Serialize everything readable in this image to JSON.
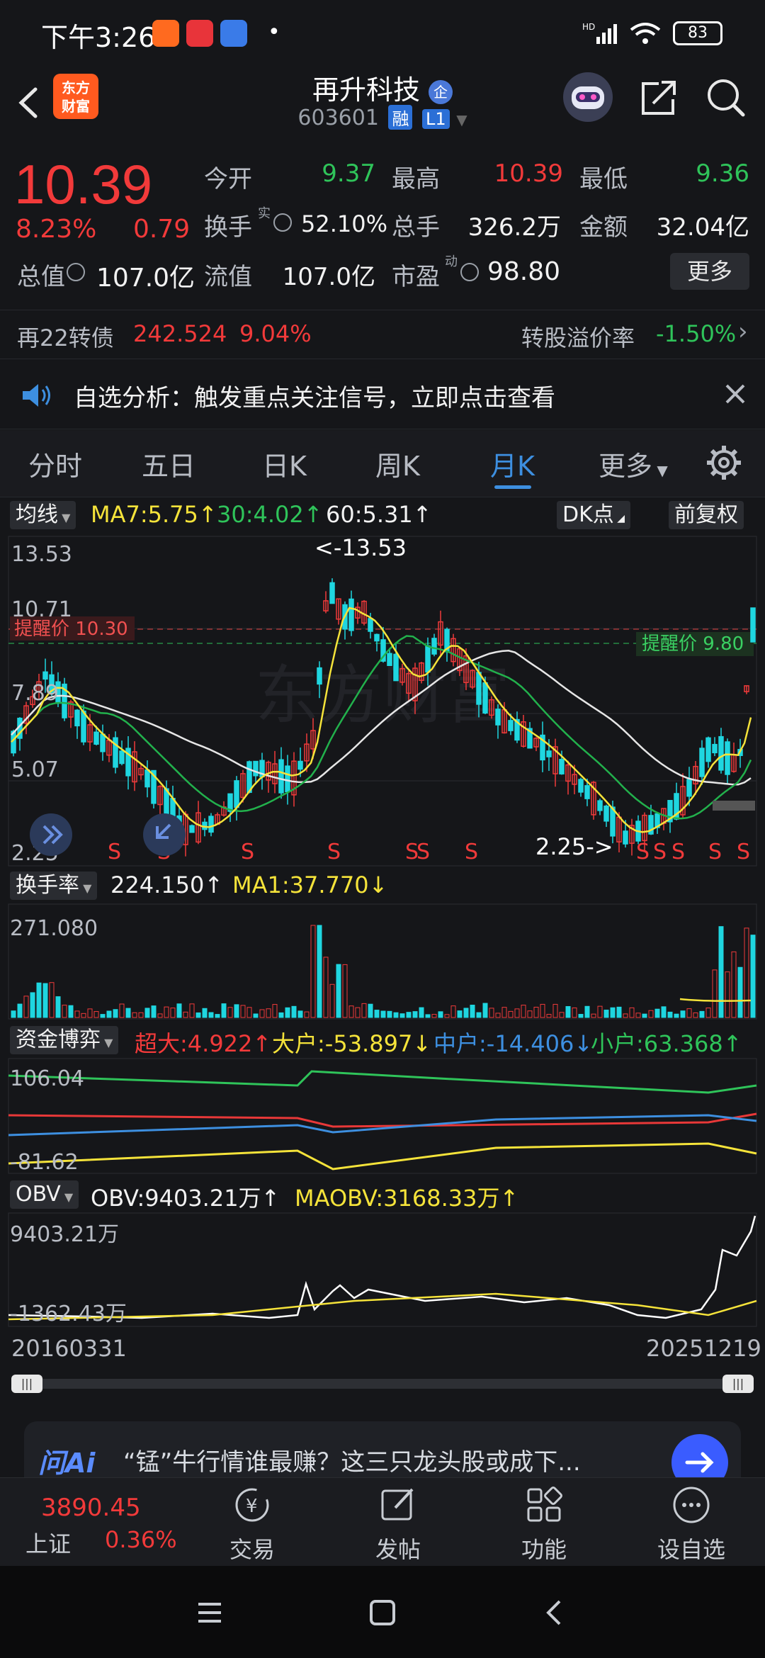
{
  "status": {
    "time": "下午3:26",
    "battery": "83",
    "signal": "HD"
  },
  "header": {
    "logo_top": "东方",
    "logo_bottom": "财富",
    "title": "再升科技",
    "title_badge": "企",
    "code": "603601",
    "badge_rong": "融",
    "badge_level": "L1"
  },
  "quote": {
    "price": "10.39",
    "pct": "8.23%",
    "change": "0.79",
    "open_label": "今开",
    "open": "9.37",
    "high_label": "最高",
    "high": "10.39",
    "low_label": "最低",
    "low": "9.36",
    "turnover_label": "换手",
    "turnover_sup": "实",
    "turnover": "52.10%",
    "volume_label": "总手",
    "volume": "326.2万",
    "amount_label": "金额",
    "amount": "32.04亿",
    "mktcap_label": "总值",
    "mktcap": "107.0亿",
    "float_label": "流值",
    "float": "107.0亿",
    "pe_label": "市盈",
    "pe_sup": "动",
    "pe": "98.80",
    "more": "更多"
  },
  "convertible": {
    "name": "再22转债",
    "price": "242.524",
    "pct": "9.04%",
    "premium_label": "转股溢价率",
    "premium": "-1.50%"
  },
  "alert": {
    "text": "自选分析：触发重点关注信号，立即点击查看"
  },
  "tabs": [
    "分时",
    "五日",
    "日K",
    "周K",
    "月K",
    "更多"
  ],
  "active_tab": "月K",
  "kline": {
    "selector": "均线",
    "ma7": "MA7:5.75↑",
    "ma30": "30:4.02↑",
    "ma60": "60:5.31↑",
    "dk": "DK点",
    "fq": "前复权",
    "y_labels": [
      "13.53",
      "10.71",
      "7.89",
      "5.07",
      "2.25"
    ],
    "max_label": "<-13.53",
    "min_label": "2.25->",
    "remind_red": "提醒价 10.30",
    "remind_green": "提醒价 9.80",
    "s_marks": [
      "S",
      "S",
      "S",
      "S",
      "S",
      "S",
      "S",
      "S",
      "S",
      "S",
      "S"
    ],
    "watermark": "东方财富"
  },
  "turnover_panel": {
    "selector": "换手率",
    "value": "224.150↑",
    "ma": "MA1:37.770↓",
    "y_label": "271.080"
  },
  "fund_panel": {
    "selector": "资金博弈",
    "super": "超大:4.922↑",
    "big": "大户:-53.897↓",
    "mid": "中户:-14.406↓",
    "small": "小户:63.368↑",
    "y_top": "106.04",
    "y_bottom": "-81.62"
  },
  "obv_panel": {
    "selector": "OBV",
    "obv": "OBV:9403.21万↑",
    "maobv": "MAOBV:3168.33万↑",
    "y_top": "9403.21万",
    "y_bottom": "-1362.43万"
  },
  "dates": {
    "start": "20160331",
    "end": "20251219"
  },
  "ai_bar": {
    "logo": "问Ai",
    "text": "“锰”牛行情谁最赚？这三只龙头股或成下..."
  },
  "bottom_nav": {
    "index_value": "3890.45",
    "index_name": "上证",
    "index_pct": "0.36%",
    "trade": "交易",
    "post": "发帖",
    "func": "功能",
    "watch": "设自选"
  }
}
